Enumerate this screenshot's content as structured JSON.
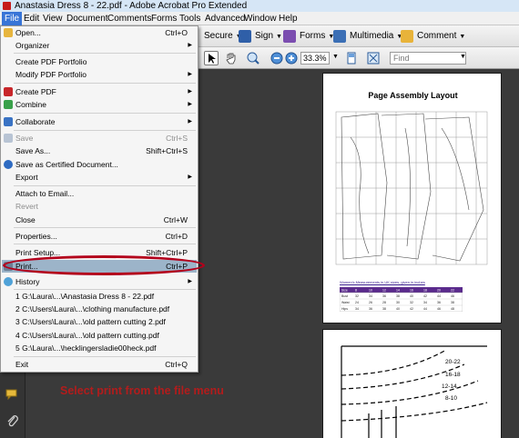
{
  "window": {
    "title": "Anastasia Dress 8 - 22.pdf - Adobe Acrobat Pro Extended"
  },
  "menubar": [
    {
      "label": "File",
      "active": true
    },
    {
      "label": "Edit"
    },
    {
      "label": "View"
    },
    {
      "label": "Document"
    },
    {
      "label": "Comments"
    },
    {
      "label": "Forms"
    },
    {
      "label": "Tools"
    },
    {
      "label": "Advanced"
    },
    {
      "label": "Window"
    },
    {
      "label": "Help"
    }
  ],
  "toolbar": {
    "secure": "Secure",
    "sign": "Sign",
    "forms": "Forms",
    "multimedia": "Multimedia",
    "comment": "Comment",
    "zoom": "33.3%",
    "find_placeholder": "Find"
  },
  "file_menu": [
    {
      "label": "Open...",
      "shortcut": "Ctrl+O",
      "icon": "open-folder-icon"
    },
    {
      "label": "Organizer",
      "submenu": true
    },
    {
      "label": "Create PDF Portfolio"
    },
    {
      "label": "Modify PDF Portfolio",
      "submenu": true
    },
    {
      "label": "Create PDF",
      "submenu": true,
      "icon": "create-pdf-icon"
    },
    {
      "label": "Combine",
      "submenu": true,
      "icon": "combine-icon"
    },
    {
      "label": "Collaborate",
      "submenu": true,
      "icon": "collaborate-icon"
    },
    {
      "label": "Save",
      "shortcut": "Ctrl+S",
      "disabled": true,
      "icon": "save-icon"
    },
    {
      "label": "Save As...",
      "shortcut": "Shift+Ctrl+S"
    },
    {
      "label": "Save as Certified Document...",
      "icon": "certify-icon"
    },
    {
      "label": "Export",
      "submenu": true
    },
    {
      "label": "Attach to Email...",
      "icon": "email-icon"
    },
    {
      "label": "Revert",
      "disabled": true
    },
    {
      "label": "Close",
      "shortcut": "Ctrl+W"
    },
    {
      "label": "Properties...",
      "shortcut": "Ctrl+D"
    },
    {
      "label": "Print Setup...",
      "shortcut": "Shift+Ctrl+P"
    },
    {
      "label": "Print...",
      "shortcut": "Ctrl+P",
      "highlighted": true,
      "icon": "print-icon"
    },
    {
      "label": "History",
      "submenu": true,
      "icon": "history-icon"
    },
    {
      "label": "1 G:\\Laura\\...\\Anastasia Dress 8 - 22.pdf"
    },
    {
      "label": "2 C:\\Users\\Laura\\...\\clothing manufacture.pdf"
    },
    {
      "label": "3 C:\\Users\\Laura\\...\\old pattern cutting 2.pdf"
    },
    {
      "label": "4 C:\\Users\\Laura\\...\\old pattern cutting.pdf"
    },
    {
      "label": "5 G:\\Laura\\...\\hecklingersladie00heck.pdf"
    },
    {
      "label": "Exit",
      "shortcut": "Ctrl+Q"
    }
  ],
  "document": {
    "page_title": "Page Assembly Layout",
    "measurements_title": "Women's Measurements in UK sizes, given in inches",
    "measurements_table": {
      "header": [
        "Size",
        "8",
        "10",
        "12",
        "14",
        "16",
        "18",
        "20",
        "22"
      ],
      "rows": [
        [
          "Bust",
          "32",
          "34",
          "36",
          "38",
          "40",
          "42",
          "44",
          "46"
        ],
        [
          "Waist",
          "24",
          "26",
          "28",
          "30",
          "32",
          "34",
          "36",
          "38"
        ],
        [
          "Hips",
          "34",
          "36",
          "38",
          "40",
          "42",
          "44",
          "46",
          "48"
        ]
      ]
    },
    "size_labels": [
      "20-22",
      "16-18",
      "12-14",
      "8-10"
    ]
  },
  "instruction": "Select print from the file menu",
  "colors": {
    "accent": "#3875d7",
    "callout": "#b3001b",
    "instruction": "#b21c1c",
    "table_header": "#5a2a8c"
  }
}
